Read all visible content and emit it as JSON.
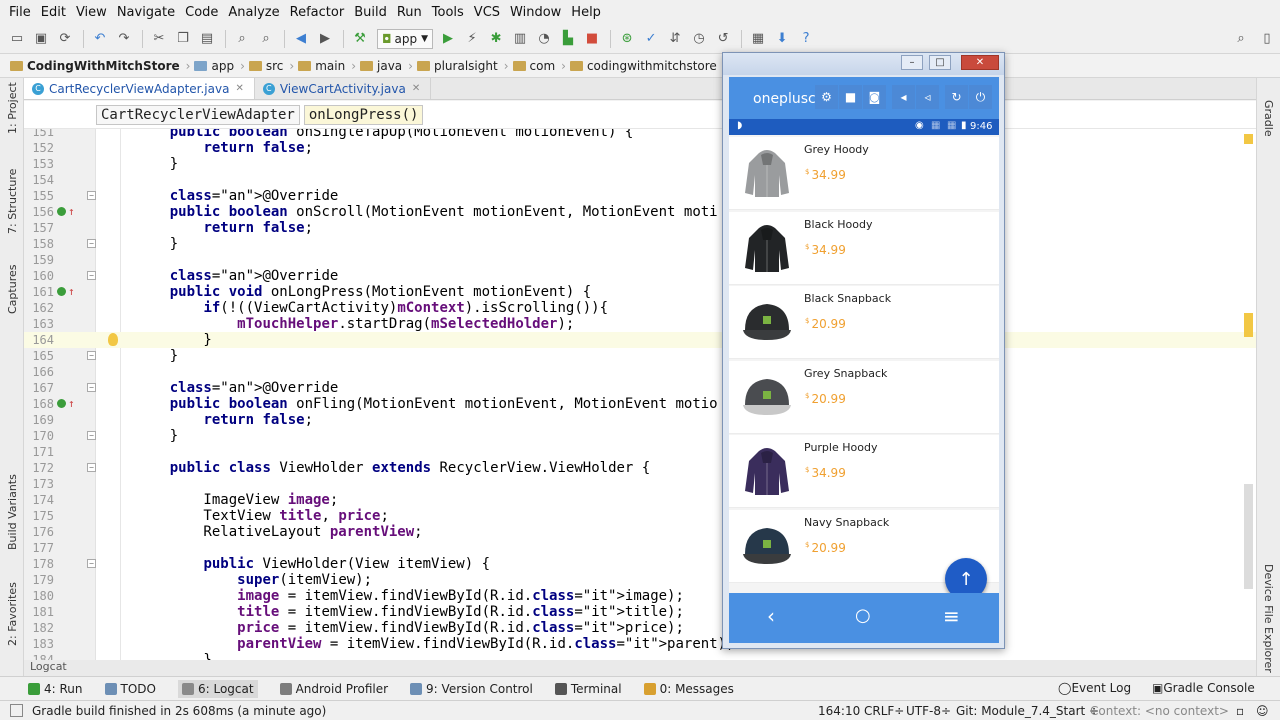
{
  "menu": [
    "File",
    "Edit",
    "View",
    "Navigate",
    "Code",
    "Analyze",
    "Refactor",
    "Build",
    "Run",
    "Tools",
    "VCS",
    "Window",
    "Help"
  ],
  "toolbar": {
    "run_config": "app"
  },
  "breadcrumbs": [
    "CodingWithMitchStore",
    "app",
    "src",
    "main",
    "java",
    "pluralsight",
    "com",
    "codingwithmitchstore",
    "CartR"
  ],
  "tabs": [
    {
      "label": "CartRecyclerViewAdapter.java",
      "active": true
    },
    {
      "label": "ViewCartActivity.java",
      "active": false
    }
  ],
  "editor_breadcrumb": [
    "CartRecyclerViewAdapter",
    "onLongPress()"
  ],
  "code_lines": [
    {
      "n": "151",
      "t": "    public boolean onSingleTapUp(MotionEvent motionEvent) {"
    },
    {
      "n": "152",
      "t": "        return false;"
    },
    {
      "n": "153",
      "t": "    }"
    },
    {
      "n": "154",
      "t": ""
    },
    {
      "n": "155",
      "t": "    @Override"
    },
    {
      "n": "156",
      "t": "    public boolean onScroll(MotionEvent motionEvent, MotionEvent moti"
    },
    {
      "n": "157",
      "t": "        return false;"
    },
    {
      "n": "158",
      "t": "    }"
    },
    {
      "n": "159",
      "t": ""
    },
    {
      "n": "160",
      "t": "    @Override"
    },
    {
      "n": "161",
      "t": "    public void onLongPress(MotionEvent motionEvent) {"
    },
    {
      "n": "162",
      "t": "        if(!((ViewCartActivity)mContext).isScrolling()){"
    },
    {
      "n": "163",
      "t": "            mTouchHelper.startDrag(mSelectedHolder);"
    },
    {
      "n": "164",
      "t": "        }"
    },
    {
      "n": "165",
      "t": "    }"
    },
    {
      "n": "166",
      "t": ""
    },
    {
      "n": "167",
      "t": "    @Override"
    },
    {
      "n": "168",
      "t": "    public boolean onFling(MotionEvent motionEvent, MotionEvent motio"
    },
    {
      "n": "169",
      "t": "        return false;"
    },
    {
      "n": "170",
      "t": "    }"
    },
    {
      "n": "171",
      "t": ""
    },
    {
      "n": "172",
      "t": "    public class ViewHolder extends RecyclerView.ViewHolder {"
    },
    {
      "n": "173",
      "t": ""
    },
    {
      "n": "174",
      "t": "        ImageView image;"
    },
    {
      "n": "175",
      "t": "        TextView title, price;"
    },
    {
      "n": "176",
      "t": "        RelativeLayout parentView;"
    },
    {
      "n": "177",
      "t": ""
    },
    {
      "n": "178",
      "t": "        public ViewHolder(View itemView) {"
    },
    {
      "n": "179",
      "t": "            super(itemView);"
    },
    {
      "n": "180",
      "t": "            image = itemView.findViewById(R.id.image);"
    },
    {
      "n": "181",
      "t": "            title = itemView.findViewById(R.id.title);"
    },
    {
      "n": "182",
      "t": "            price = itemView.findViewById(R.id.price);"
    },
    {
      "n": "183",
      "t": "            parentView = itemView.findViewById(R.id.parent);"
    },
    {
      "n": "184",
      "t": "        }"
    }
  ],
  "left_tools": [
    "1: Project",
    "7: Structure",
    "Captures",
    "Build Variants",
    "2: Favorites"
  ],
  "right_tools": [
    "Gradle",
    "Device File Explorer"
  ],
  "logcat_label": "Logcat",
  "bottom_tools": [
    {
      "label": "4: Run",
      "icon": "run-icon"
    },
    {
      "label": "TODO",
      "icon": "todo-icon"
    },
    {
      "label": "6: Logcat",
      "icon": "logcat-icon"
    },
    {
      "label": "Android Profiler",
      "icon": "profiler-icon"
    },
    {
      "label": "9: Version Control",
      "icon": "vcs-icon"
    },
    {
      "label": "Terminal",
      "icon": "terminal-icon"
    },
    {
      "label": "0: Messages",
      "icon": "messages-icon"
    }
  ],
  "bottom_right": [
    "Event Log",
    "Gradle Console"
  ],
  "status": {
    "message": "Gradle build finished in 2s 608ms (a minute ago)",
    "position": "164:10",
    "line_sep": "CRLF÷",
    "encoding": "UTF-8÷",
    "git": "Git: Module_7.4_Start ÷",
    "context": "Context: <no context>"
  },
  "emulator": {
    "title": "oneplusc",
    "time": "9:46",
    "products": [
      {
        "name": "Grey Hoody",
        "currency": "$",
        "price": "34.99",
        "kind": "hoody",
        "color": "#9a9c9e"
      },
      {
        "name": "Black Hoody",
        "currency": "$",
        "price": "34.99",
        "kind": "hoody",
        "color": "#222426"
      },
      {
        "name": "Black Snapback",
        "currency": "$",
        "price": "20.99",
        "kind": "cap",
        "color": "#2a2c2e"
      },
      {
        "name": "Grey Snapback",
        "currency": "$",
        "price": "20.99",
        "kind": "cap",
        "color": "#4a4c50"
      },
      {
        "name": "Purple Hoody",
        "currency": "$",
        "price": "34.99",
        "kind": "hoody",
        "color": "#3a2d5c"
      },
      {
        "name": "Navy Snapback",
        "currency": "$",
        "price": "20.99",
        "kind": "cap",
        "color": "#26384a"
      }
    ]
  }
}
